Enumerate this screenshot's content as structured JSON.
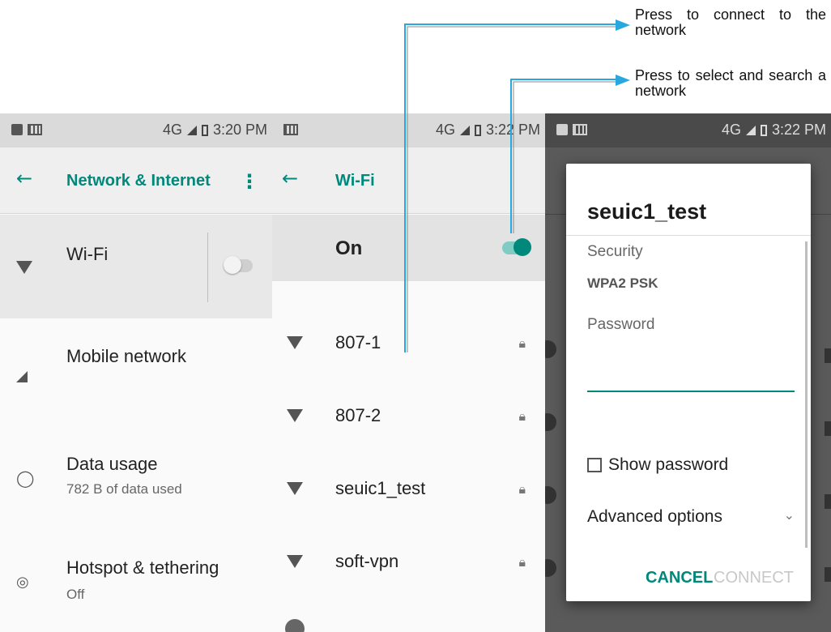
{
  "annotations": {
    "connect_note": "Press to connect to the network",
    "select_note": "Press to select and search a network"
  },
  "colors": {
    "accent": "#00897b",
    "arrow": "#29a8e0"
  },
  "status_bar": {
    "network": "4G",
    "time_1": "3:20 PM",
    "time_2": "3:22 PM",
    "time_3": "3:22 PM"
  },
  "network_screen": {
    "title": "Network & Internet",
    "items": [
      {
        "label": "Wi-Fi",
        "icon": "wifi-icon"
      },
      {
        "label": "Mobile network",
        "icon": "signal-icon"
      },
      {
        "label": "Data usage",
        "sub": "782 B of data used",
        "icon": "data-usage-icon"
      },
      {
        "label": "Hotspot & tethering",
        "sub": "Off",
        "icon": "hotspot-icon"
      }
    ]
  },
  "wifi_screen": {
    "title": "Wi-Fi",
    "toggle_label": "On",
    "networks": [
      {
        "name": "807-1"
      },
      {
        "name": "807-2"
      },
      {
        "name": "seuic1_test"
      },
      {
        "name": "soft-vpn"
      }
    ]
  },
  "dialog": {
    "title": "seuic1_test",
    "security_label": "Security",
    "security_value": "WPA2 PSK",
    "password_label": "Password",
    "password_value": "",
    "show_password": "Show password",
    "advanced_options": "Advanced options",
    "cancel": "CANCEL",
    "connect": "CONNECT"
  }
}
